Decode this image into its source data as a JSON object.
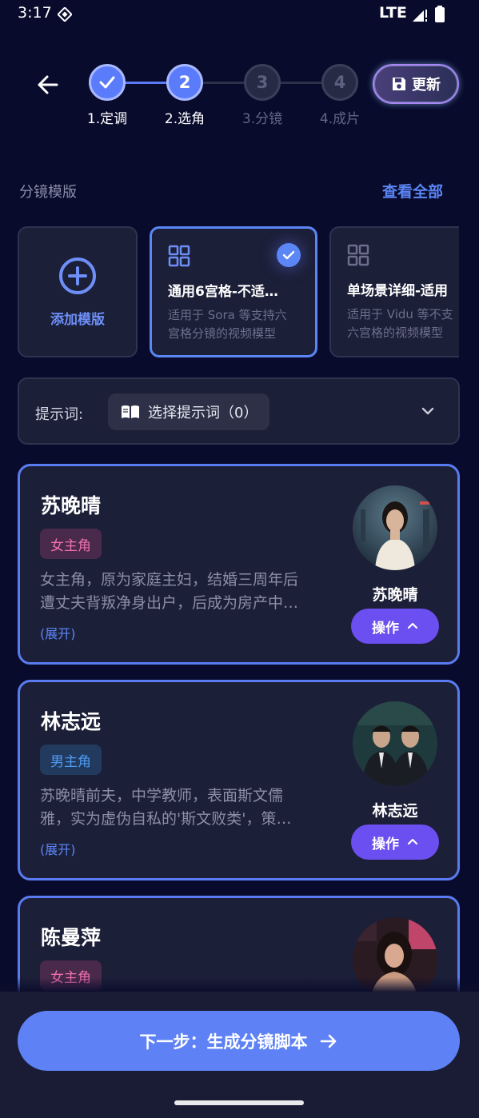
{
  "status_bar": {
    "time": "3:17",
    "network": "LTE"
  },
  "stepper": {
    "steps": [
      {
        "number": "1",
        "label": "1.定调",
        "state": "done"
      },
      {
        "number": "2",
        "label": "2.选角",
        "state": "active"
      },
      {
        "number": "3",
        "label": "3.分镜",
        "state": "todo"
      },
      {
        "number": "4",
        "label": "4.成片",
        "state": "todo"
      }
    ]
  },
  "header": {
    "update_label": "更新"
  },
  "templates": {
    "section_title": "分镜模版",
    "view_all_label": "查看全部",
    "add_label": "添加模版",
    "items": [
      {
        "name": "通用6宫格-不适…",
        "desc_line1": "适用于 Sora 等支持六",
        "desc_line2": "宫格分镜的视频模型",
        "selected": true
      },
      {
        "name": "单场景详细-适用",
        "desc_line1": "适用于 Vidu 等不支",
        "desc_line2": "六宫格的视频模型",
        "selected": false
      }
    ]
  },
  "prompt": {
    "label": "提示词:",
    "select_label": "选择提示词（0）"
  },
  "characters": [
    {
      "name": "苏晚晴",
      "role": "女主角",
      "desc_line1": "女主角，原为家庭主妇，结婚三周年后",
      "desc_line2": "遭丈夫背叛净身出户，后成为房产中…",
      "expand_label": "(展开)",
      "avatar_name": "苏晚晴",
      "action_label": "操作"
    },
    {
      "name": "林志远",
      "role": "男主角",
      "desc_line1": "苏晚晴前夫，中学教师，表面斯文儒",
      "desc_line2": "雅，实为虚伪自私的'斯文败类'，策…",
      "expand_label": "(展开)",
      "avatar_name": "林志远",
      "action_label": "操作"
    },
    {
      "name": "陈曼萍",
      "role": "女主角"
    }
  ],
  "footer": {
    "next_label": "下一步：生成分镜脚本"
  },
  "colors": {
    "background": "#090b2c",
    "card": "#1c1f38",
    "accent": "#5b86f5",
    "action_purple": "#6b4ff0",
    "female_badge": "#f06fb0",
    "male_badge": "#4f9bf2"
  },
  "icons": [
    "back-arrow-icon",
    "check-icon",
    "save-icon",
    "plus-circle-icon",
    "grid-icon",
    "book-icon",
    "chevron-down-icon",
    "chevron-up-icon",
    "arrow-right-icon"
  ]
}
